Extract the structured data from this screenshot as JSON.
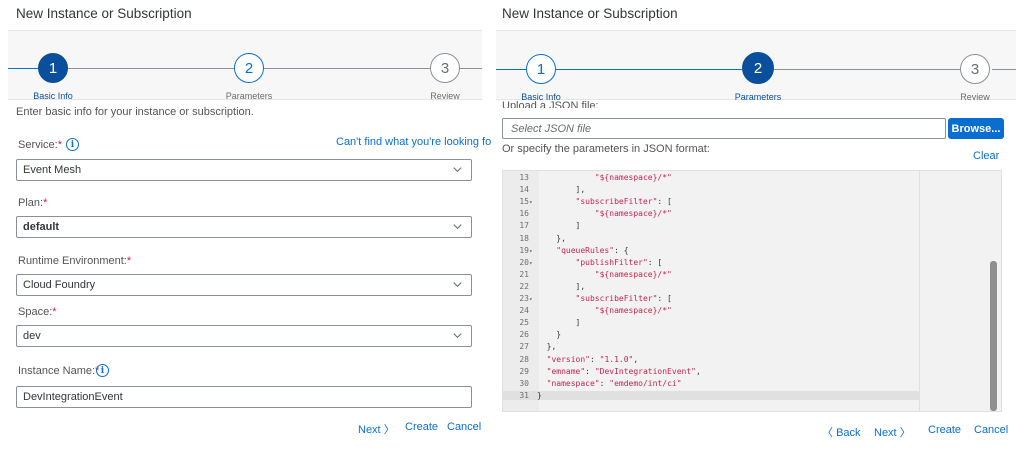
{
  "left": {
    "title": "New Instance or Subscription",
    "steps": [
      {
        "number": "1",
        "label": "Basic Info"
      },
      {
        "number": "2",
        "label": "Parameters"
      },
      {
        "number": "3",
        "label": "Review"
      }
    ],
    "intro": "Enter basic info for your instance or subscription.",
    "service_label": "Service:",
    "cant_find_link": "Can't find what you're looking for?",
    "service_value": "Event Mesh",
    "plan_label": "Plan:",
    "plan_value": "default",
    "runtime_label": "Runtime Environment:",
    "runtime_value": "Cloud Foundry",
    "space_label": "Space:",
    "space_value": "dev",
    "instance_label": "Instance Name:",
    "instance_value": "DevIntegrationEvent",
    "footer": {
      "next": "Next",
      "create": "Create",
      "cancel": "Cancel"
    },
    "required_mark": "*",
    "info_glyph": "i"
  },
  "right": {
    "title": "New Instance or Subscription",
    "steps": [
      {
        "number": "1",
        "label": "Basic Info"
      },
      {
        "number": "2",
        "label": "Parameters"
      },
      {
        "number": "3",
        "label": "Review"
      }
    ],
    "upload_label": "Upload a JSON file:",
    "json_placeholder": "Select JSON file",
    "browse_label": "Browse...",
    "specify_label": "Or specify the parameters in JSON format:",
    "clear_label": "Clear",
    "code_lines": [
      {
        "n": "13",
        "fold": "",
        "text": "            \"${namespace}/*\""
      },
      {
        "n": "14",
        "fold": "",
        "text": "        ],"
      },
      {
        "n": "15",
        "fold": "▾",
        "text": "        \"subscribeFilter\": ["
      },
      {
        "n": "16",
        "fold": "",
        "text": "            \"${namespace}/*\""
      },
      {
        "n": "17",
        "fold": "",
        "text": "        ]"
      },
      {
        "n": "18",
        "fold": "",
        "text": "    },"
      },
      {
        "n": "19",
        "fold": "▾",
        "text": "    \"queueRules\": {"
      },
      {
        "n": "20",
        "fold": "▾",
        "text": "        \"publishFilter\": ["
      },
      {
        "n": "21",
        "fold": "",
        "text": "            \"${namespace}/*\""
      },
      {
        "n": "22",
        "fold": "",
        "text": "        ],"
      },
      {
        "n": "23",
        "fold": "▾",
        "text": "        \"subscribeFilter\": ["
      },
      {
        "n": "24",
        "fold": "",
        "text": "            \"${namespace}/*\""
      },
      {
        "n": "25",
        "fold": "",
        "text": "        ]"
      },
      {
        "n": "26",
        "fold": "",
        "text": "    }"
      },
      {
        "n": "27",
        "fold": "",
        "text": "  },"
      },
      {
        "n": "28",
        "fold": "",
        "text": "  \"version\": \"1.1.0\","
      },
      {
        "n": "29",
        "fold": "",
        "text": "  \"emname\": \"DevIntegrationEvent\","
      },
      {
        "n": "30",
        "fold": "",
        "text": "  \"namespace\": \"emdemo/int/ci\""
      },
      {
        "n": "31",
        "fold": "",
        "text": "}"
      }
    ],
    "footer": {
      "back": "Back",
      "next": "Next",
      "create": "Create",
      "cancel": "Cancel"
    }
  },
  "colors": {
    "accent": "#0a6ed1",
    "current_step": "#0a4f9c",
    "required": "#d32030"
  },
  "icons": {
    "info": "info-icon",
    "dropdown": "chevron-down-icon",
    "next": "chevron-right-icon",
    "back": "chevron-left-icon"
  }
}
